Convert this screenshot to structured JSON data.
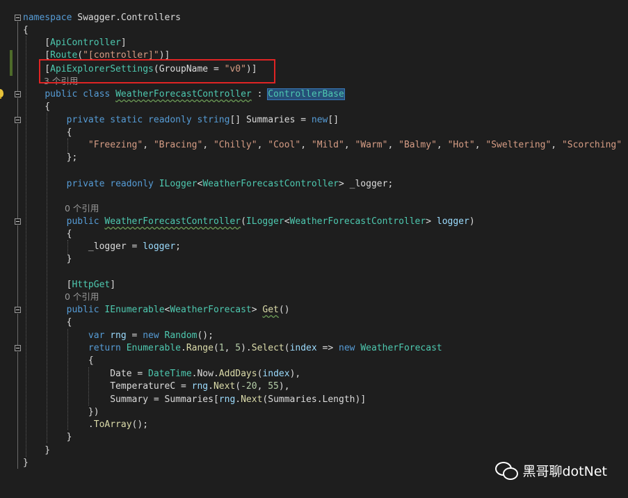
{
  "code": {
    "namespace_keyword": "namespace",
    "namespace_name": " Swagger.Controllers",
    "attr_api_controller": "ApiController",
    "attr_route": "Route",
    "route_arg": "\"[controller]\"",
    "attr_explorer": "ApiExplorerSettings",
    "explorer_param": "GroupName = ",
    "explorer_value": "\"v0\"",
    "refs_class": "3 个引用",
    "public_kw": "public",
    "class_kw": "class",
    "class_name": "WeatherForecastController",
    "base_class": "ControllerBase",
    "private_kw": "private",
    "static_kw": "static",
    "readonly_kw": "readonly",
    "string_kw": "string",
    "summaries_name": "Summaries",
    "new_kw": "new",
    "summary_values": [
      "\"Freezing\"",
      "\"Bracing\"",
      "\"Chilly\"",
      "\"Cool\"",
      "\"Mild\"",
      "\"Warm\"",
      "\"Balmy\"",
      "\"Hot\"",
      "\"Sweltering\"",
      "\"Scorching\""
    ],
    "ilogger_type": "ILogger",
    "logger_field": "_logger",
    "refs_ctor": "0 个引用",
    "logger_param": "logger",
    "attr_httpget": "HttpGet",
    "refs_get": "0 个引用",
    "ienumerable": "IEnumerable",
    "wf_type": "WeatherForecast",
    "get_method": "Get",
    "var_kw": "var",
    "rng": "rng",
    "random_type": "Random",
    "return_kw": "return",
    "enumerable": "Enumerable",
    "range_call": "Range",
    "num_1": "1",
    "num_5": "5",
    "select_call": "Select",
    "index_param": "index",
    "date_prop": "Date",
    "datetime": "DateTime",
    "now_prop": "Now",
    "adddays": "AddDays",
    "tempc_prop": "TemperatureC",
    "next_call": "Next",
    "num_m20": "-20",
    "num_55": "55",
    "summary_prop": "Summary",
    "length_prop": "Length",
    "toarray": "ToArray"
  },
  "watermark": {
    "text": "黑哥聊dotNet",
    "icon": "wechat-icon"
  },
  "colors": {
    "background": "#1e1e1e",
    "keyword": "#569cd6",
    "type": "#4ec9b0",
    "string": "#d69d85",
    "highlight_box": "#e02424"
  }
}
